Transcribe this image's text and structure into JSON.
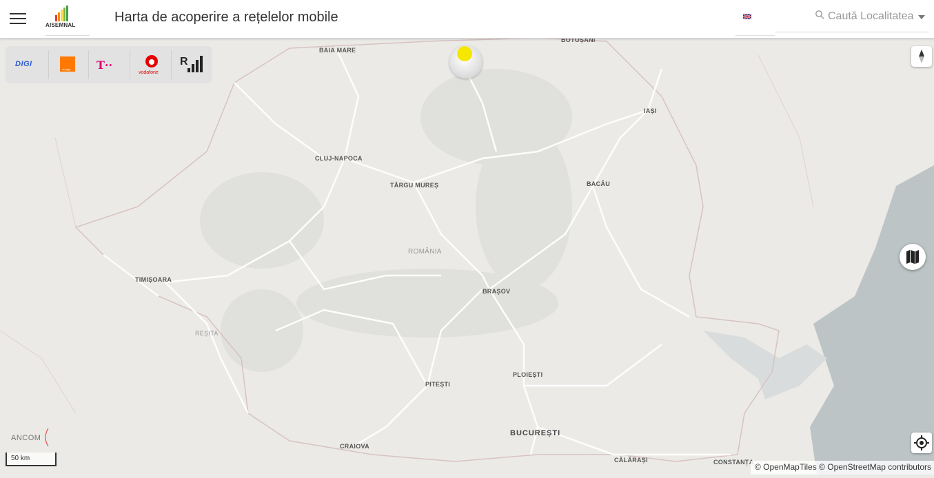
{
  "header": {
    "title": "Harta de acoperire a rețelelor mobile",
    "logo_text": "AISEMNAL",
    "search_label": "Caută Localitatea"
  },
  "operators": [
    {
      "name": "DIGI",
      "color": "#2f5bd0"
    },
    {
      "name": "orange",
      "color": "#ff7900"
    },
    {
      "name": "T··",
      "color": "#e20074"
    },
    {
      "name": "vodafone",
      "color": "#e60000"
    },
    {
      "name": "R",
      "color": "#222222"
    }
  ],
  "map": {
    "places": {
      "baia_mare": "BAIA MARE",
      "botosani": "BOTOȘANI",
      "iasi": "IAȘI",
      "cluj": "CLUJ-NAPOCA",
      "targu_mures": "TÂRGU MUREȘ",
      "bacau": "BACĂU",
      "romania": "ROMÂNIA",
      "timisoara": "TIMIȘOARA",
      "brasov": "BRAȘOV",
      "resita": "REȘITA",
      "pitesti": "PITEȘTI",
      "ploiesti": "PLOIEȘTI",
      "bucuresti": "BUCUREȘTI",
      "craiova": "CRAIOVA",
      "calarasi": "CĂLĂRAȘI",
      "constanta": "CONSTANȚA"
    },
    "marker_color": "#f6e700",
    "water_color": "#bcc4c6"
  },
  "controls": {
    "scale_label": "50 km",
    "ancom_label": "ANCOM",
    "attribution": "© OpenMapTiles © OpenStreetMap contributors"
  }
}
